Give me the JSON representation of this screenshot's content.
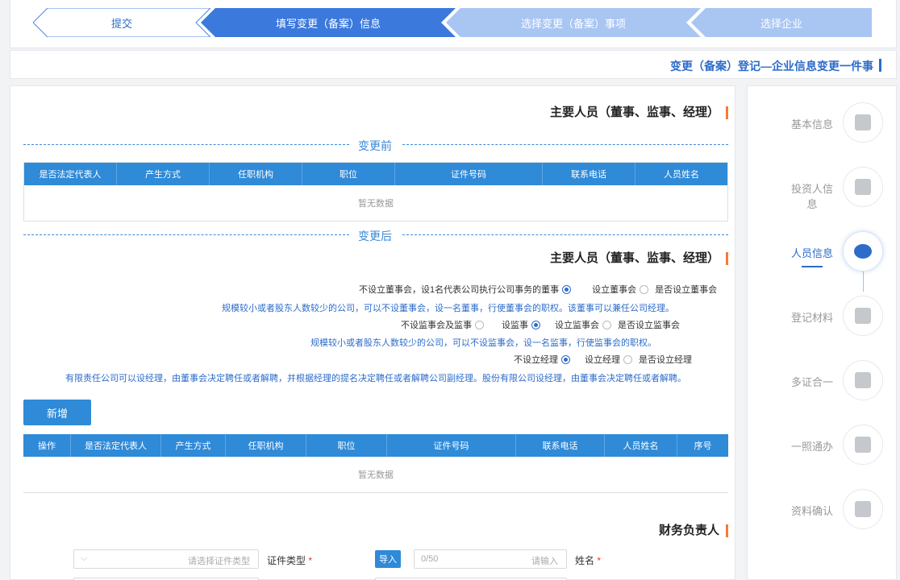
{
  "steps": [
    "提交",
    "填写变更（备案）信息",
    "选择变更（备案）事项",
    "选择企业"
  ],
  "page_title": "变更（备案）登记—企业信息变更一件事",
  "nav": [
    {
      "label": "基本信息",
      "icon": "document-icon",
      "active": false
    },
    {
      "label": "投资人信息",
      "icon": "investor-icon",
      "active": false
    },
    {
      "label": "人员信息",
      "icon": "people-icon",
      "active": true
    },
    {
      "label": "登记材料",
      "icon": "shield-icon",
      "active": false
    },
    {
      "label": "多证合一",
      "icon": "certificate-icon",
      "active": false
    },
    {
      "label": "一照通办",
      "icon": "license-icon",
      "active": false
    },
    {
      "label": "资料确认",
      "icon": "file-check-icon",
      "active": false
    }
  ],
  "section1": {
    "title": "主要人员（董事、监事、经理）",
    "before_label": "变更前",
    "after_label": "变更后",
    "columns_before": [
      "人员姓名",
      "联系电话",
      "证件号码",
      "职位",
      "任职机构",
      "产生方式",
      "是否法定代表人"
    ],
    "empty_text": "暂无数据"
  },
  "section2": {
    "title": "主要人员（董事、监事、经理）",
    "q_board": "是否设立董事会",
    "board_yes": "设立董事会",
    "board_no": "不设立董事会，设1名代表公司执行公司事务的董事",
    "tip_board": "规模较小或者股东人数较少的公司，可以不设董事会，设一名董事，行使董事会的职权。该董事可以兼任公司经理。",
    "q_supervisor": "是否设立监事会",
    "supervisor_yes": "设立监事会",
    "supervisor_mid": "设监事",
    "supervisor_no": "不设监事会及监事",
    "tip_supervisor": "规模较小或者股东人数较少的公司，可以不设监事会，设一名监事，行使监事会的职权。",
    "q_manager": "是否设立经理",
    "manager_yes": "设立经理",
    "manager_no": "不设立经理",
    "tip_manager": "有限责任公司可以设经理，由董事会决定聘任或者解聘，并根据经理的提名决定聘任或者解聘公司副经理。股份有限公司设经理，由董事会决定聘任或者解聘。",
    "add_button": "新增",
    "columns_after": [
      "序号",
      "人员姓名",
      "联系电话",
      "证件号码",
      "职位",
      "任职机构",
      "产生方式",
      "是否法定代表人",
      "操作"
    ],
    "empty_text": "暂无数据"
  },
  "finance": {
    "title": "财务负责人",
    "name_label": "姓名",
    "name_placeholder": "请输入",
    "name_counter": "0/50",
    "import_button": "导入",
    "id_type_label": "证件类型",
    "id_type_placeholder": "请选择证件类型"
  },
  "colors": {
    "primary": "#2d6cc9",
    "header_blue": "#2f8ad8",
    "accent_orange": "#f07c3c"
  }
}
